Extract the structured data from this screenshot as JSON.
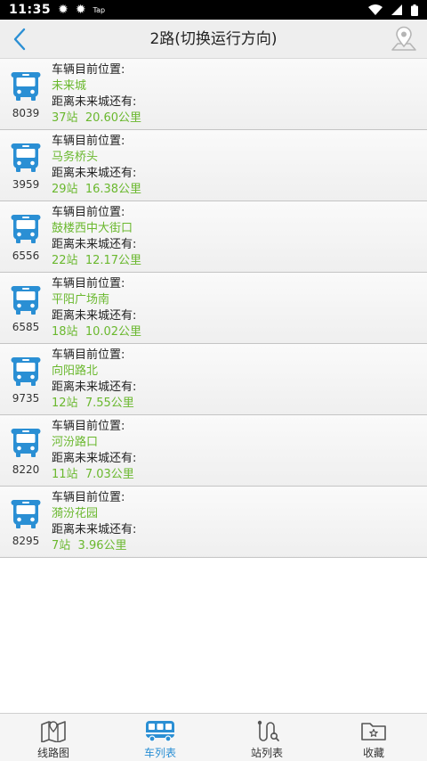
{
  "status_bar": {
    "time": "11:35",
    "icons": [
      "weather-icon",
      "weather-icon"
    ],
    "tag": "Tap"
  },
  "header": {
    "title": "2路(切换运行方向)",
    "back_icon": "back-chevron-icon",
    "map_icon": "map-pin-icon"
  },
  "labels": {
    "position": "车辆目前位置:",
    "distance": "距离未来城还有:"
  },
  "buses": [
    {
      "id": "8039",
      "location": "未来城",
      "stops": "37站",
      "distance": "20.60公里"
    },
    {
      "id": "3959",
      "location": "马务桥头",
      "stops": "29站",
      "distance": "16.38公里"
    },
    {
      "id": "6556",
      "location": "鼓楼西中大街口",
      "stops": "22站",
      "distance": "12.17公里"
    },
    {
      "id": "6585",
      "location": "平阳广场南",
      "stops": "18站",
      "distance": "10.02公里"
    },
    {
      "id": "9735",
      "location": "向阳路北",
      "stops": "12站",
      "distance": "7.55公里"
    },
    {
      "id": "8220",
      "location": "河汾路口",
      "stops": "11站",
      "distance": "7.03公里"
    },
    {
      "id": "8295",
      "location": "漪汾花园",
      "stops": "7站",
      "distance": "3.96公里"
    }
  ],
  "tabs": [
    {
      "label": "线路图",
      "icon": "route-map-icon",
      "active": false
    },
    {
      "label": "车列表",
      "icon": "bus-icon",
      "active": true
    },
    {
      "label": "站列表",
      "icon": "station-list-icon",
      "active": false
    },
    {
      "label": "收藏",
      "icon": "favorites-folder-icon",
      "active": false
    }
  ],
  "colors": {
    "accent": "#2a8fd4",
    "value_green": "#6ab82e",
    "header_bg": "#eeeeee"
  }
}
